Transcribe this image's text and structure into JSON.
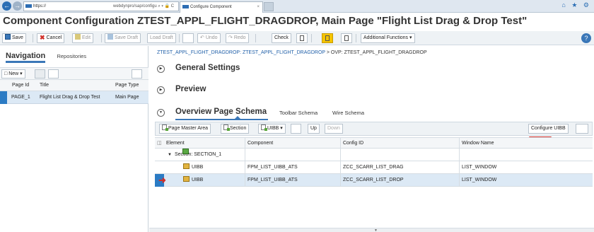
{
  "browser": {
    "url": "https://",
    "url_rest": "webdynpro/sap/configu",
    "url_controls": "⌕ ▾ 🔒 C",
    "tab_title": "Configure Component",
    "tab_close": "×",
    "right_icons": "⌂ ★ ⚙"
  },
  "page_title": "Component Configuration ZTEST_APPL_FLIGHT_DRAGDROP, Main Page \"Flight List Drag & Drop Test\"",
  "toolbar": {
    "save": "Save",
    "cancel": "Cancel",
    "edit": "Edit",
    "save_draft": "Save Draft",
    "load_draft": "Load Draft",
    "undo": "Undo",
    "redo": "Redo",
    "check": "Check",
    "additional": "Additional Functions",
    "help": "?"
  },
  "navigation": {
    "tab_active": "Navigation",
    "tab_other": "Repositories",
    "new_button": "New",
    "columns": [
      "Page Id",
      "Title",
      "Page Type"
    ],
    "rows": [
      {
        "page_id": "PAGE_1",
        "title": "Flight List Drag & Drop Test",
        "page_type": "Main Page"
      }
    ]
  },
  "breadcrumb": {
    "link": "ZTEST_APPL_FLIGHT_DRAGDROP: ZTEST_APPL_FLIGHT_DRAGDROP",
    "current": " > OVP: ZTEST_APPL_FLIGHT_DRAGDROP"
  },
  "sections": {
    "general": "General Settings",
    "preview": "Preview",
    "schema": "Overview Page Schema",
    "toolbar_schema": "Toolbar Schema",
    "wire_schema": "Wire Schema"
  },
  "grid_toolbar": {
    "page_master": "Page Master Area",
    "section": "Section",
    "uibb": "UIBB",
    "up": "Up",
    "down": "Down",
    "configure": "Configure UIBB"
  },
  "grid": {
    "columns": [
      "Element",
      "Component",
      "Config ID",
      "Window Name"
    ],
    "rows": [
      {
        "element": "Section: SECTION_1",
        "component": "",
        "config_id": "",
        "window": ""
      },
      {
        "element": "UIBB",
        "component": "FPM_LIST_UIBB_ATS",
        "config_id": "ZCC_SCARR_LIST_DRAG",
        "window": "LIST_WINDOW"
      },
      {
        "element": "UIBB",
        "component": "FPM_LIST_UIBB_ATS",
        "config_id": "ZCC_SCARR_LIST_DROP",
        "window": "LIST_WINDOW"
      }
    ]
  },
  "colors": {
    "accent": "#3a77b8",
    "selection": "#dce9f5",
    "highlight_marker": "#d0302a"
  }
}
